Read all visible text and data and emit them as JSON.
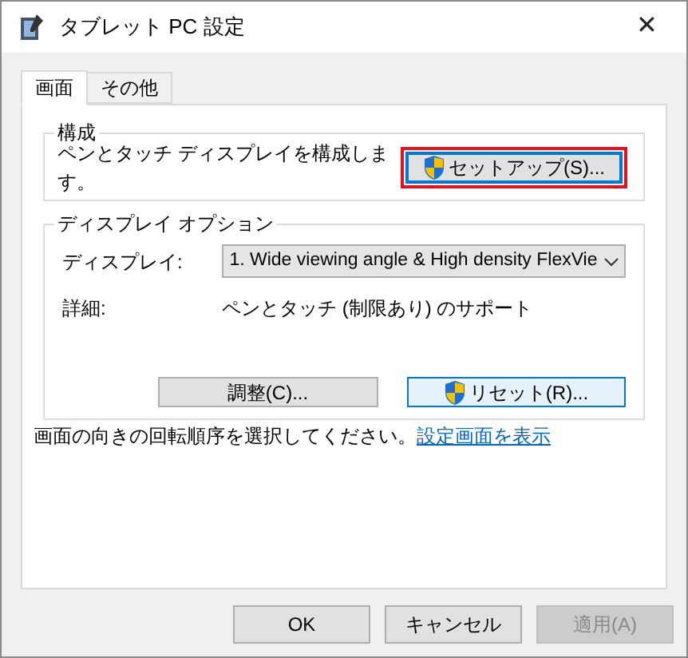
{
  "window": {
    "title": "タブレット PC 設定",
    "close": "✕"
  },
  "tabs": [
    {
      "label": "画面",
      "selected": true
    },
    {
      "label": "その他",
      "selected": false
    }
  ],
  "config_group": {
    "title": "構成",
    "description": "ペンとタッチ ディスプレイを構成します。",
    "setup_button": {
      "label": "セットアップ(S)...",
      "highlighted": true
    }
  },
  "display_group": {
    "title": "ディスプレイ オプション",
    "display_label": "ディスプレイ:",
    "display_value": "1. Wide viewing angle & High density FlexVie",
    "details_label": "詳細:",
    "details_value": "ペンとタッチ (制限あり) のサポート",
    "adjust_button": {
      "label": "調整(C)...",
      "hovered": false
    },
    "reset_button": {
      "label": "リセット(R)...",
      "hovered": true
    }
  },
  "rotation_text": "画面の向きの回転順序を選択してください。",
  "rotation_link": "設定画面を表示",
  "buttons": [
    {
      "label": "OK",
      "disabled": false
    },
    {
      "label": "キャンセル",
      "disabled": false
    },
    {
      "label": "適用(A)",
      "disabled": true
    }
  ]
}
